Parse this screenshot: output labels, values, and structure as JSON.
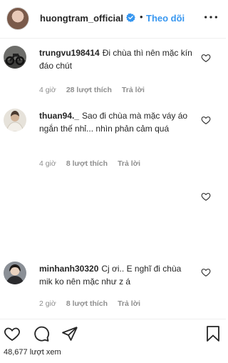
{
  "header": {
    "username": "huongtram_official",
    "dot": "•",
    "follow_label": "Theo dõi"
  },
  "comments": [
    {
      "username": "trungvu198414",
      "text": "Đi chùa thì nên mặc kín đáo chút",
      "time": "4 giờ",
      "likes": "28 lượt thích",
      "reply": "Trả lời"
    },
    {
      "username": "thuan94._",
      "text": "Sao đi chùa mà mặc váy áo ngắn thế nhỉ... nhìn phản cảm quá",
      "time": "4 giờ",
      "likes": "8 lượt thích",
      "reply": "Trả lời"
    },
    {
      "username": "minhanh30320",
      "text": "Cj ơi.. E nghĩ đi chùa mik ko nên mặc như z á",
      "time": "2 giờ",
      "likes": "8 lượt thích",
      "reply": "Trả lời"
    }
  ],
  "footer": {
    "views": "48,677 lượt xem"
  },
  "icons": {
    "verified": "verified-badge-icon",
    "more": "more-options-icon",
    "heart": "heart-icon",
    "comment": "comment-icon",
    "share": "share-icon",
    "save": "bookmark-icon"
  },
  "colors": {
    "follow": "#3897f0",
    "muted": "#8e8e8e",
    "text": "#262626"
  }
}
